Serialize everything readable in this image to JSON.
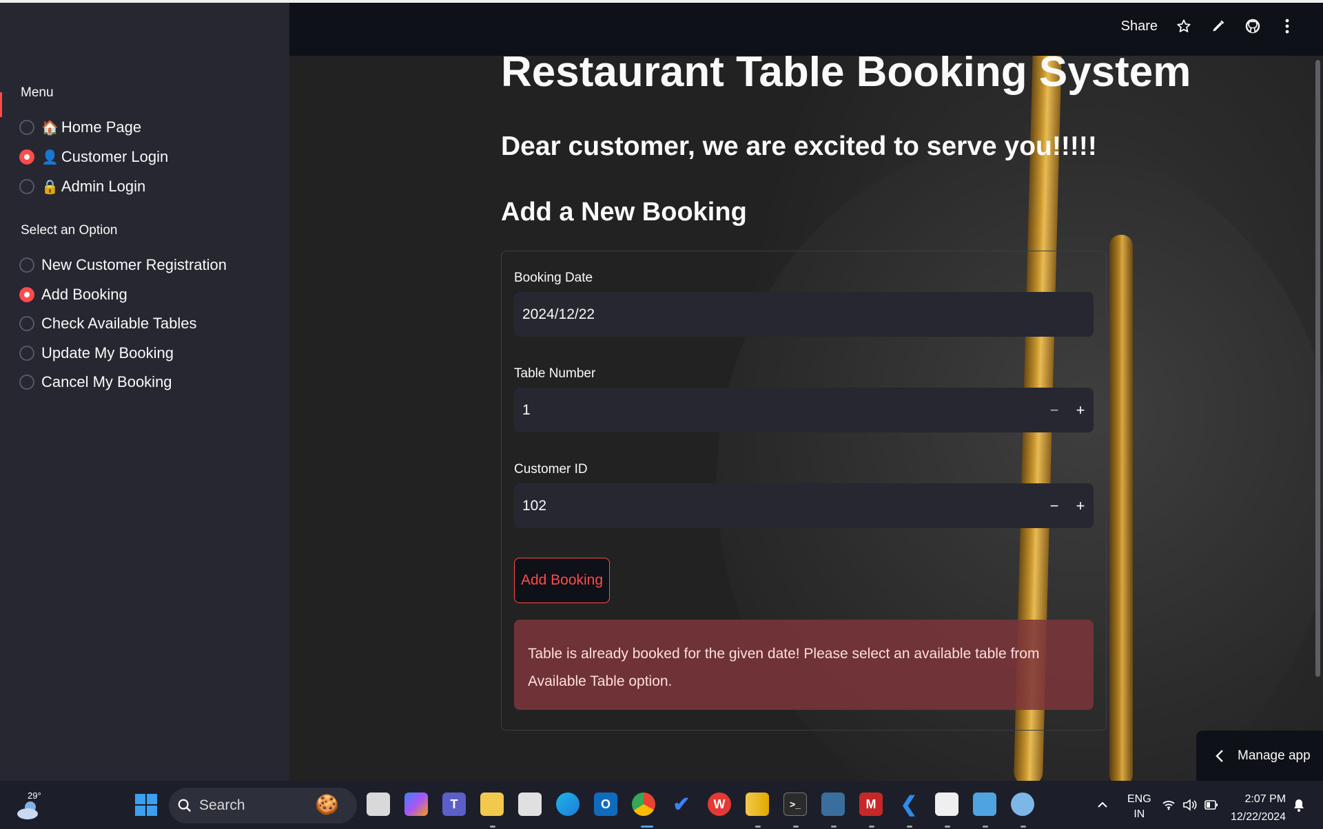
{
  "app": {
    "title": "Restaurant Table Booking System"
  },
  "header": {
    "share_label": "Share"
  },
  "sidebar": {
    "menu_label": "Menu",
    "menu_items": [
      {
        "emoji": "🏠",
        "label": "Home Page",
        "selected": false
      },
      {
        "emoji": "👤",
        "label": "Customer Login",
        "selected": true
      },
      {
        "emoji": "🔒",
        "label": "Admin Login",
        "selected": false
      }
    ],
    "option_label": "Select an Option",
    "options": [
      {
        "label": "New Customer Registration",
        "selected": false
      },
      {
        "label": "Add Booking",
        "selected": true
      },
      {
        "label": "Check Available Tables",
        "selected": false
      },
      {
        "label": "Update My Booking",
        "selected": false
      },
      {
        "label": "Cancel My Booking",
        "selected": false
      }
    ]
  },
  "main": {
    "subtitle": "Dear customer, we are excited to serve you!!!!!",
    "section_title": "Add a New Booking",
    "form": {
      "booking_date_label": "Booking Date",
      "booking_date_value": "2024/12/22",
      "table_number_label": "Table Number",
      "table_number_value": "1",
      "customer_id_label": "Customer ID",
      "customer_id_value": "102",
      "minus_symbol": "−",
      "plus_symbol": "+",
      "submit_label": "Add Booking"
    },
    "error_message": "Table is already booked for the given date! Please select an available table from Available Table option.",
    "manage_app_label": "Manage app"
  },
  "taskbar": {
    "weather_temp": "29°",
    "search_placeholder": "Search",
    "language": "ENG",
    "region": "IN",
    "time": "2:07 PM",
    "date": "12/22/2024"
  },
  "colors": {
    "accent": "#ff4b4b",
    "sidebar_bg": "#262730",
    "app_bg": "#0e1117",
    "error_bg": "#7d353a"
  }
}
